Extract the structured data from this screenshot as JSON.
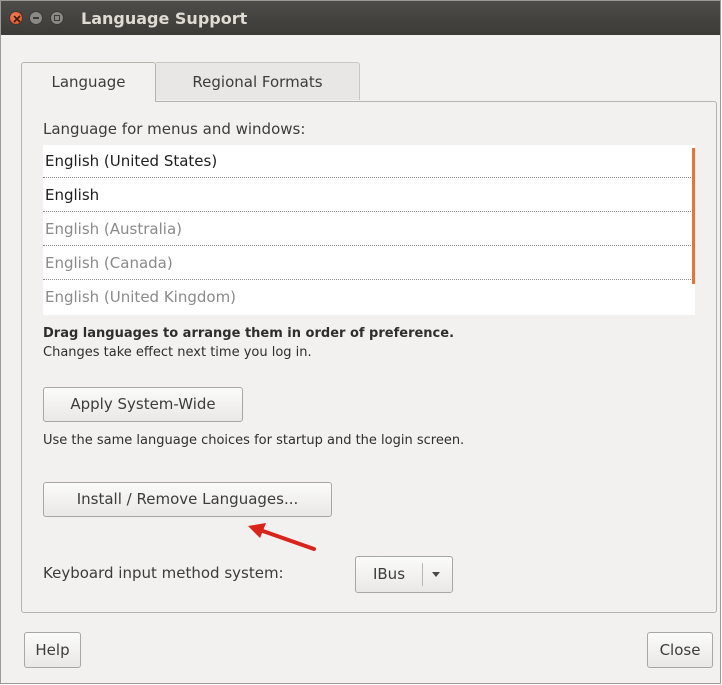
{
  "window": {
    "title": "Language Support"
  },
  "tabs": [
    {
      "label": "Language",
      "active": true
    },
    {
      "label": "Regional Formats",
      "active": false
    }
  ],
  "language_tab": {
    "list_label": "Language for menus and windows:",
    "languages": [
      {
        "name": "English (United States)",
        "enabled": true
      },
      {
        "name": "English",
        "enabled": true
      },
      {
        "name": "English (Australia)",
        "enabled": false
      },
      {
        "name": "English (Canada)",
        "enabled": false
      },
      {
        "name": "English (United Kingdom)",
        "enabled": false
      }
    ],
    "drag_hint": "Drag languages to arrange them in order of preference.",
    "changes_hint": "Changes take effect next time you log in.",
    "apply_button": "Apply System-Wide",
    "apply_hint": "Use the same language choices for startup and the login screen.",
    "install_button": "Install / Remove Languages...",
    "keyboard_label": "Keyboard input method system:",
    "keyboard_value": "IBus"
  },
  "footer": {
    "help_button": "Help",
    "close_button": "Close"
  },
  "colors": {
    "titlebar": "#3c3b37",
    "close_button": "#df4a16",
    "accent": "#e2733b",
    "annotation_arrow": "#d9241c"
  }
}
